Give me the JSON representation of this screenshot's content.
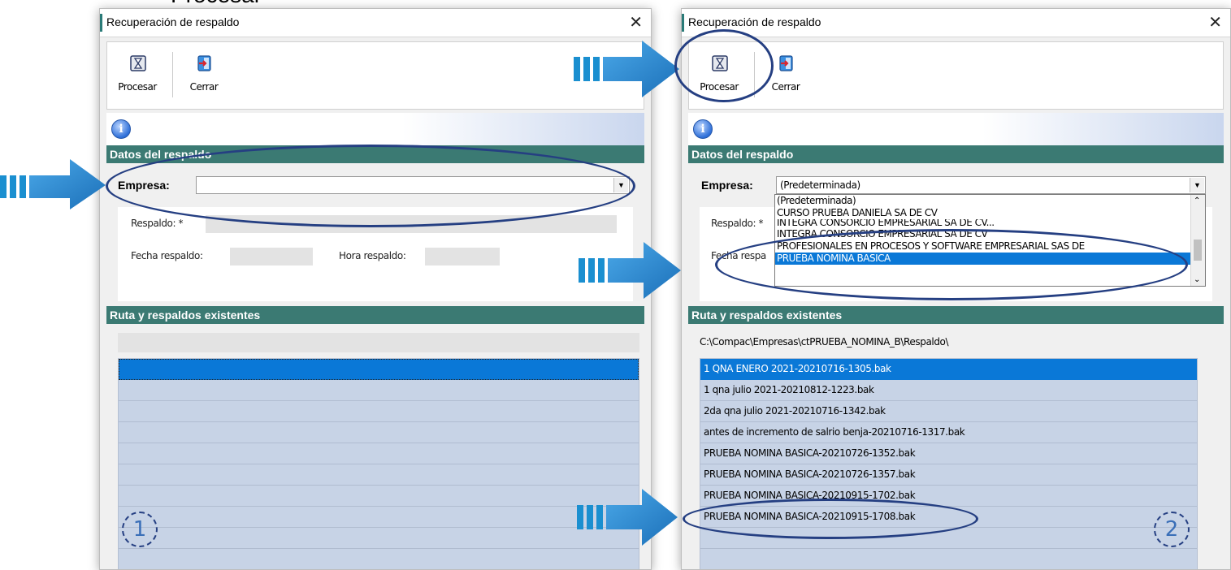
{
  "page_heading": "Procesar",
  "window_title": "Recuperación de respaldo",
  "toolbar": {
    "process_label": "Procesar",
    "close_label": "Cerrar"
  },
  "sections": {
    "backup_data": "Datos del respaldo",
    "route_backups": "Ruta y respaldos existentes"
  },
  "fields": {
    "company_label": "Empresa:",
    "backup_label": "Respaldo: *",
    "backup_date_label": "Fecha respaldo:",
    "backup_time_label": "Hora respaldo:"
  },
  "left": {
    "company_value": "",
    "backup_value": "",
    "date_value": "",
    "time_value": "",
    "path": "",
    "step_badge": "1"
  },
  "right": {
    "company_value": "(Predeterminada)",
    "backup_label_partial": "Respaldo: *",
    "date_label_partial": "Fecha respa",
    "path": "C:\\Compac\\Empresas\\ctPRUEBA_NOMINA_B\\Respaldo\\",
    "company_options": [
      "(Predeterminada)",
      "CURSO PRUEBA DANIELA SA DE CV",
      "INTEGRA CONSORCIO EMPRESARIAL SA DE CV...",
      "INTEGRA CONSORCIO EMPRESARIAL SA DE CV",
      "PROFESIONALES EN PROCESOS Y SOFTWARE EMPRESARIAL SAS DE",
      "PRUEBA NOMINA BASICA"
    ],
    "selected_company": "PRUEBA NOMINA BASICA",
    "backups": [
      "1 QNA ENERO 2021-20210716-1305.bak",
      "1 qna julio 2021-20210812-1223.bak",
      "2da qna julio 2021-20210716-1342.bak",
      "antes de incremento de salrio benja-20210716-1317.bak",
      "PRUEBA NOMINA BASICA-20210726-1352.bak",
      "PRUEBA NOMINA BASICA-20210726-1357.bak",
      "PRUEBA NOMINA BASICA-20210915-1702.bak",
      "PRUEBA NOMINA BASICA-20210915-1708.bak"
    ],
    "step_badge": "2"
  },
  "colors": {
    "section_bg": "#3b7a73",
    "selection": "#0a78d7",
    "annotation": "#253f82",
    "arrow": "#1a8fd0"
  }
}
